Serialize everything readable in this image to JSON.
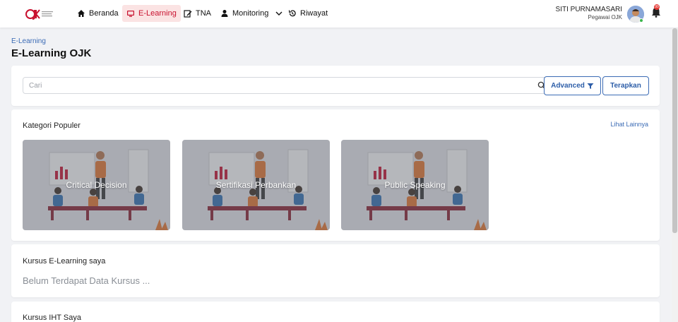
{
  "nav": {
    "items": [
      {
        "label": "Beranda",
        "icon": "home-icon"
      },
      {
        "label": "E-Learning",
        "icon": "monitor-icon"
      },
      {
        "label": "TNA",
        "icon": "edit-icon"
      },
      {
        "label": "Monitoring",
        "icon": "user-icon"
      },
      {
        "label": "Riwayat",
        "icon": "history-icon"
      }
    ],
    "active": "E-Learning",
    "accent": "#c8102e"
  },
  "user": {
    "name": "SITI PURNAMASARI",
    "role": "Pegawai OJK",
    "notifications": "99"
  },
  "breadcrumb": "E-Learning",
  "page_title": "E-Learning OJK",
  "search": {
    "placeholder": "Cari",
    "advanced_label": "Advanced",
    "apply_label": "Terapkan"
  },
  "kategori": {
    "title": "Kategori Populer",
    "see_more": "Lihat Lainnya",
    "items": [
      "Critical Decision",
      "Sertifikasi Perbankan",
      "Public Speaking"
    ]
  },
  "kursus_elearning": {
    "title": "Kursus E-Learning saya",
    "empty": "Belum Terdapat Data Kursus ..."
  },
  "kursus_iht": {
    "title": "Kursus IHT Saya"
  }
}
